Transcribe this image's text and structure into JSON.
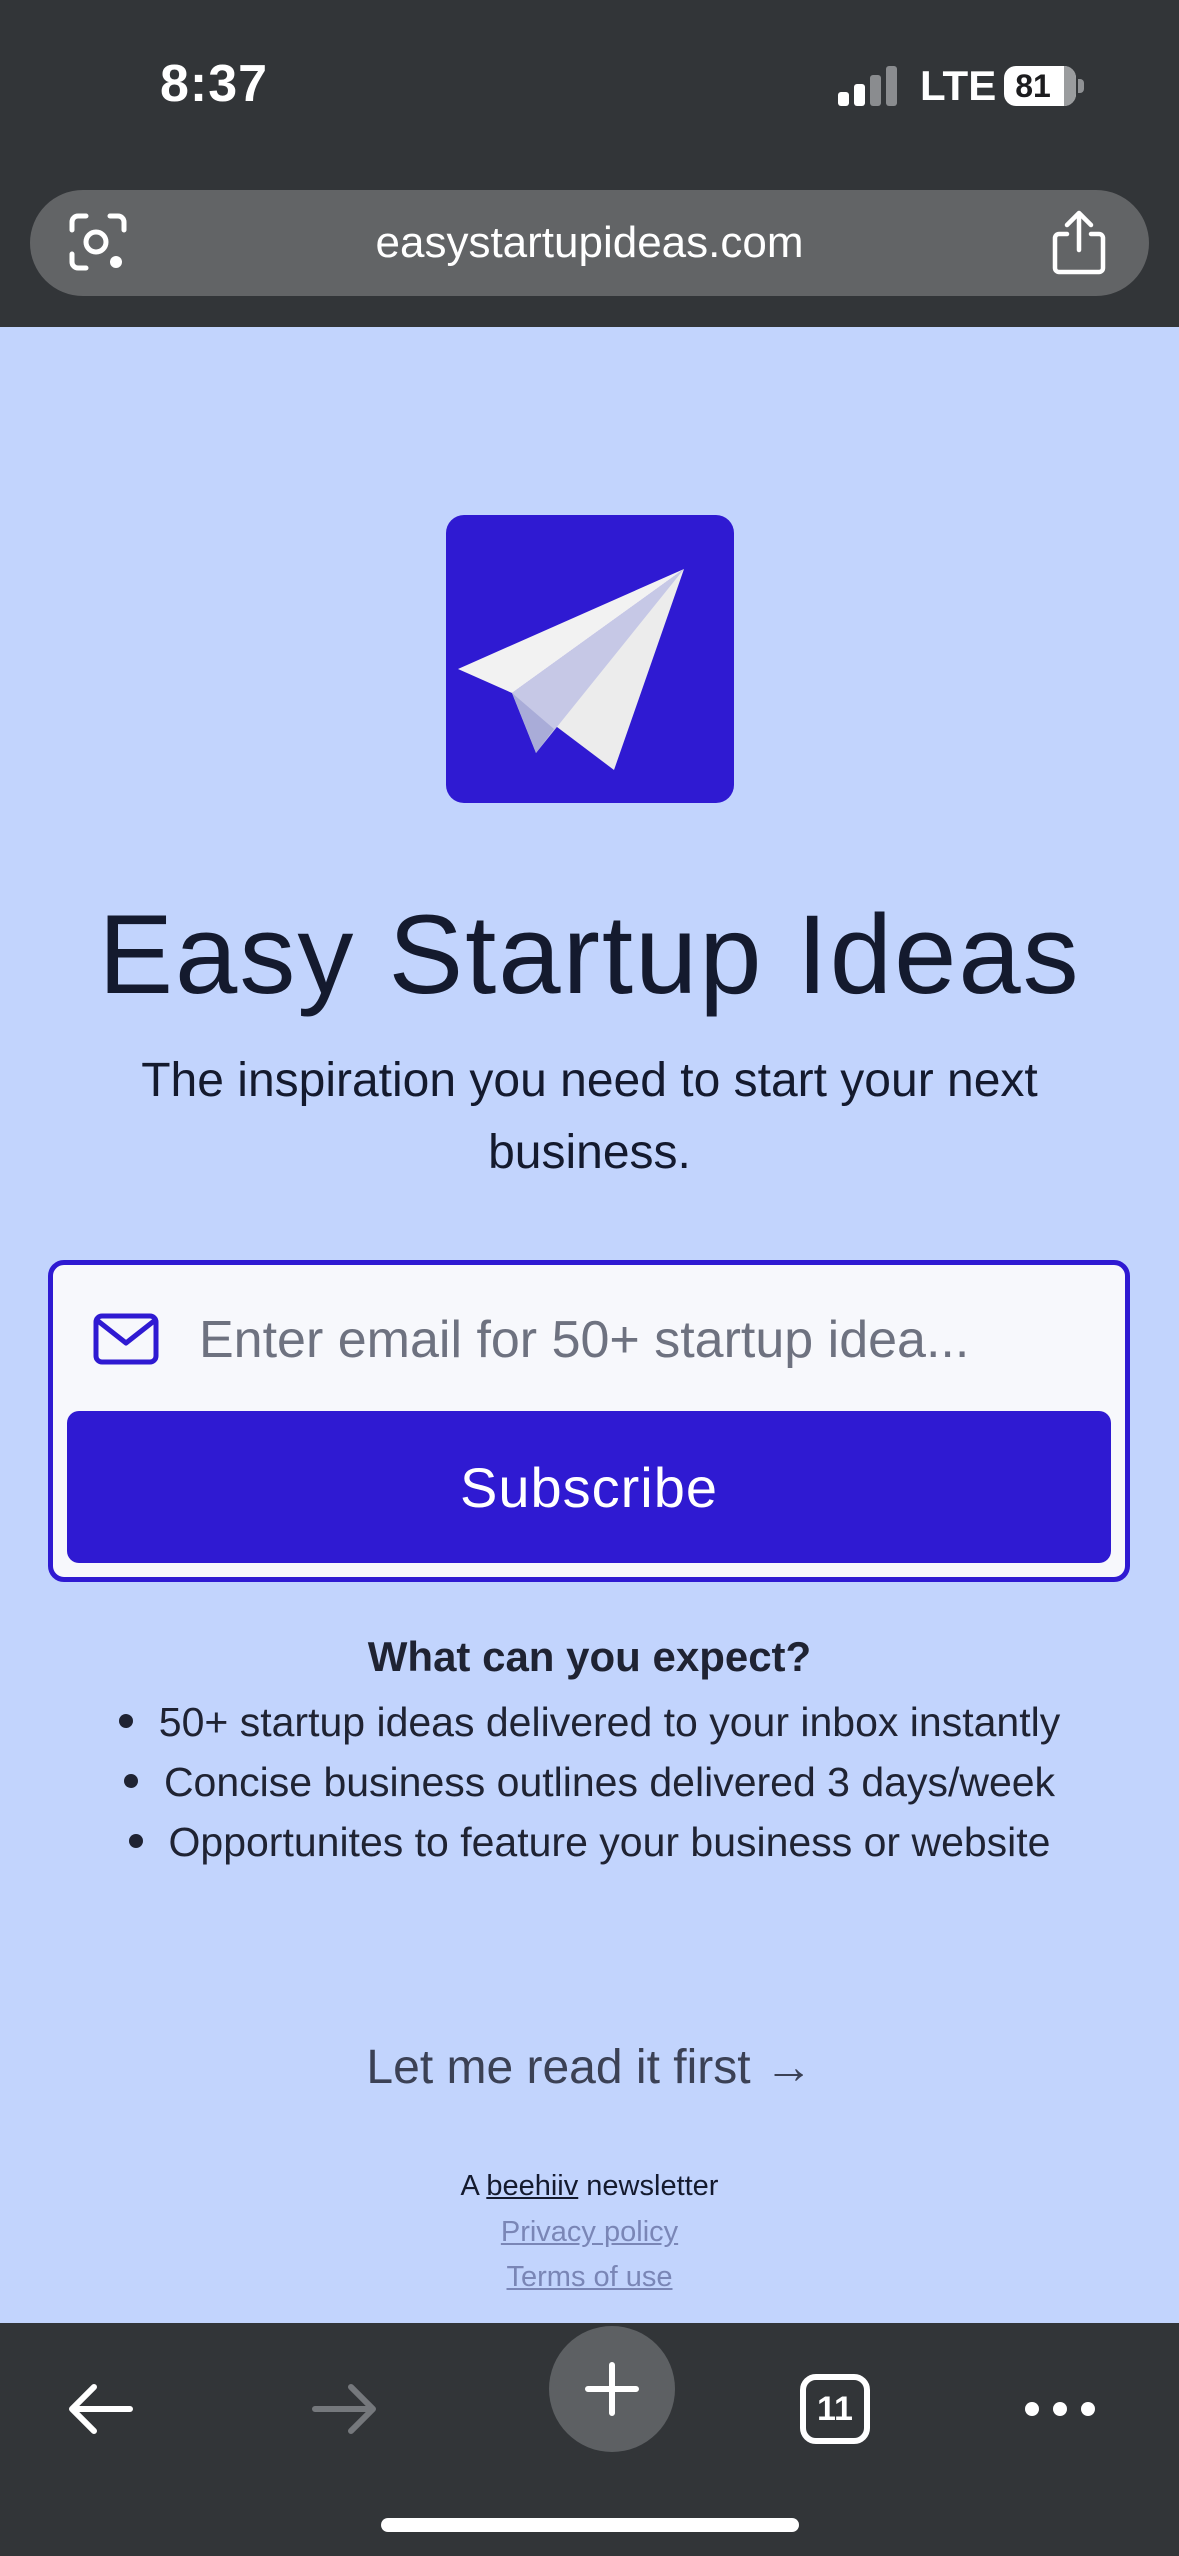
{
  "status_bar": {
    "time": "8:37",
    "network": "LTE",
    "battery": "81",
    "signal_icon": "signal-bars-icon"
  },
  "browser": {
    "url": "easystartupideas.com",
    "lens_icon": "camera-lens-icon",
    "share_icon": "share-icon"
  },
  "page": {
    "logo_icon": "paper-plane-icon",
    "title": "Easy Startup Ideas",
    "subtitle": "The inspiration you need to start your next business.",
    "signup": {
      "email_icon": "mail-icon",
      "email_value": "",
      "email_placeholder": "Enter email for 50+ startup idea...",
      "subscribe_label": "Subscribe"
    },
    "expect": {
      "heading": "What can you expect?",
      "items": [
        "50+ startup ideas delivered to your inbox instantly",
        "Concise business outlines delivered 3 days/week",
        "Opportunites to feature your business or website"
      ]
    },
    "read_first_label": "Let me read it first",
    "footer": {
      "prefix": "A",
      "brand": "beehiiv",
      "suffix": "newsletter",
      "privacy": "Privacy policy",
      "terms": "Terms of use"
    }
  },
  "toolbar": {
    "tab_count": "11",
    "back_icon": "back-arrow-icon",
    "forward_icon": "forward-arrow-icon",
    "new_tab_icon": "plus-icon",
    "more_icon": "more-dots-icon"
  },
  "colors": {
    "background": "#c2d4fd",
    "brand": "#2f1ad2",
    "chrome": "#323538",
    "text": "#141a2e"
  }
}
